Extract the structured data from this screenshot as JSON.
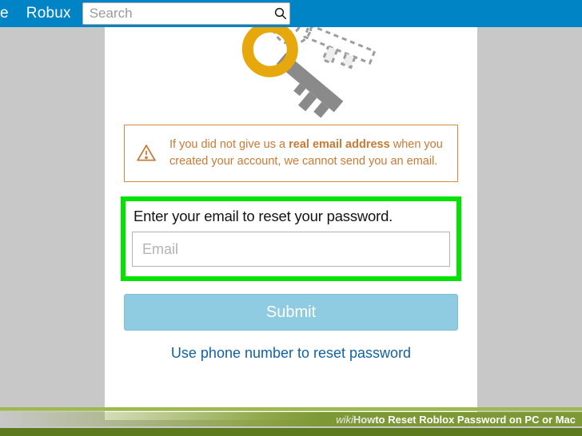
{
  "topnav": {
    "tab_partial": "e",
    "tab_robux": "Robux",
    "search_placeholder": "Search"
  },
  "notice": {
    "pre": "If you did not give us a ",
    "bold": "real email address",
    "post": " when you created your account, we cannot send you an email."
  },
  "form": {
    "prompt": "Enter your email to reset your password.",
    "email_placeholder": "Email",
    "submit": "Submit",
    "alt_link": "Use phone number to reset password"
  },
  "caption": {
    "brand_prefix": "wiki",
    "brand_suffix": "How",
    "title": " to Reset Roblox Password on PC or Mac"
  }
}
